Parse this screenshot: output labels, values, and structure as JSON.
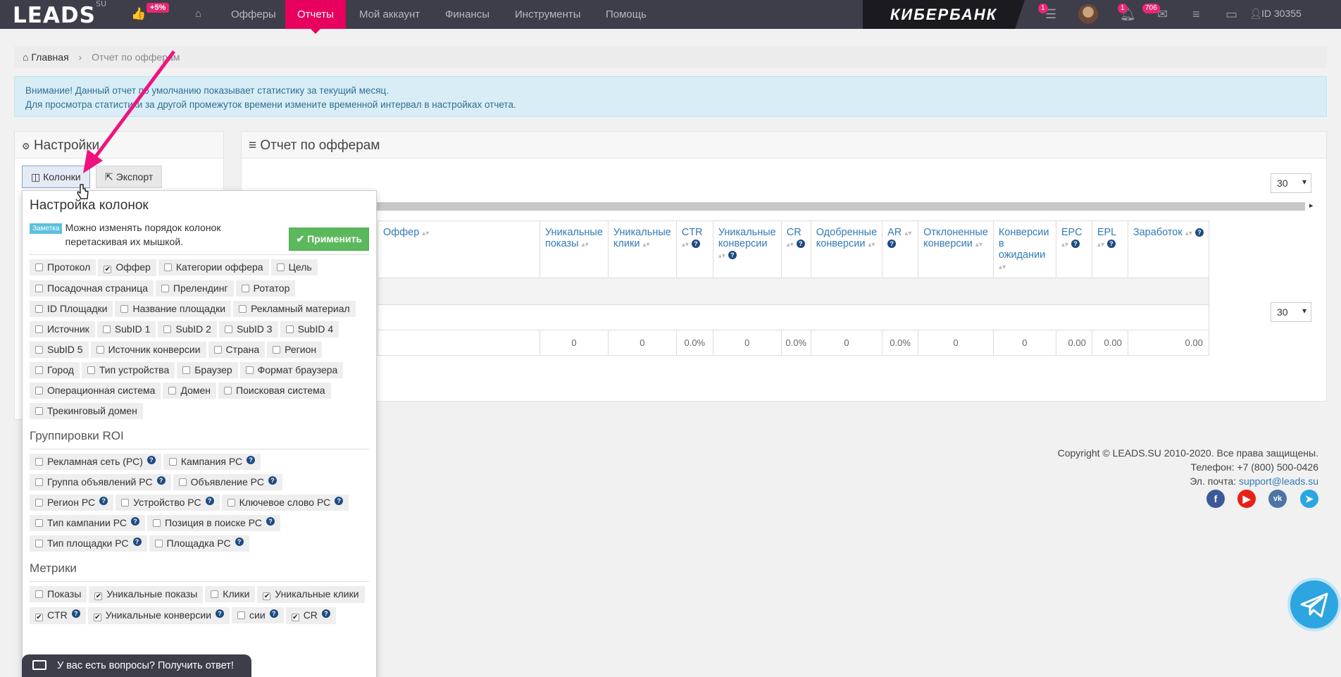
{
  "nav": {
    "logo": "LEADS",
    "logo_sup": "SU",
    "like_badge": "+5%",
    "items": [
      "Офферы",
      "Отчеты",
      "Мой аккаунт",
      "Финансы",
      "Инструменты",
      "Помощь"
    ],
    "active": "Отчеты",
    "partner_banner": "КИБЕРБАНК",
    "badge_tasks": "1",
    "badge_bell": "1",
    "badge_mail": "706",
    "user_id": "ID 30355"
  },
  "breadcrumb": {
    "home": "Главная",
    "current": "Отчет по офферам"
  },
  "alert": {
    "line1": "Внимание! Данный отчет по умолчанию показывает статистику за текущий месяц.",
    "line2": "Для просмотра статистики за другой промежуток времени измените временной интервал в настройках отчета."
  },
  "settings": {
    "title": "Настройки",
    "tab_columns": "Колонки",
    "tab_export": "Экспорт"
  },
  "report": {
    "title": "Отчет по офферам",
    "per_page": "30",
    "columns": [
      {
        "label": "Оффер",
        "help": false
      },
      {
        "label": "Уникальные показы",
        "help": false
      },
      {
        "label": "Уникальные клики",
        "help": false
      },
      {
        "label": "CTR",
        "help": true
      },
      {
        "label": "Уникальные конверсии",
        "help": true
      },
      {
        "label": "CR",
        "help": true
      },
      {
        "label": "Одобренные конверсии",
        "help": false
      },
      {
        "label": "AR",
        "help": true
      },
      {
        "label": "Отклоненные конверсии",
        "help": false
      },
      {
        "label": "Конверсии в ожидании",
        "help": false
      },
      {
        "label": "EPC",
        "help": true
      },
      {
        "label": "EPL",
        "help": true
      },
      {
        "label": "Заработок",
        "help": true
      }
    ],
    "totals": [
      "",
      "0",
      "0",
      "0.0%",
      "0",
      "0.0%",
      "0",
      "0.0%",
      "0",
      "0",
      "0.00",
      "0.00",
      "0.00"
    ]
  },
  "columns_popover": {
    "title": "Настройка колонок",
    "note_badge": "Заметка",
    "note_text": "Можно изменять порядок колонок перетаскивая их мышкой.",
    "apply": "Применить",
    "main": [
      {
        "label": "Протокол",
        "checked": false
      },
      {
        "label": "Оффер",
        "checked": true
      },
      {
        "label": "Категории оффера",
        "checked": false
      },
      {
        "label": "Цель",
        "checked": false
      },
      {
        "label": "Посадочная страница",
        "checked": false
      },
      {
        "label": "Прелендинг",
        "checked": false
      },
      {
        "label": "Ротатор",
        "checked": false
      },
      {
        "label": "ID Площадки",
        "checked": false
      },
      {
        "label": "Название площадки",
        "checked": false
      },
      {
        "label": "Рекламный материал",
        "checked": false
      },
      {
        "label": "Источник",
        "checked": false
      },
      {
        "label": "SubID 1",
        "checked": false
      },
      {
        "label": "SubID 2",
        "checked": false
      },
      {
        "label": "SubID 3",
        "checked": false
      },
      {
        "label": "SubID 4",
        "checked": false
      },
      {
        "label": "SubID 5",
        "checked": false
      },
      {
        "label": "Источник конверсии",
        "checked": false
      },
      {
        "label": "Страна",
        "checked": false
      },
      {
        "label": "Регион",
        "checked": false
      },
      {
        "label": "Город",
        "checked": false
      },
      {
        "label": "Тип устройства",
        "checked": false
      },
      {
        "label": "Браузер",
        "checked": false
      },
      {
        "label": "Формат браузера",
        "checked": false
      },
      {
        "label": "Операционная система",
        "checked": false
      },
      {
        "label": "Домен",
        "checked": false
      },
      {
        "label": "Поисковая система",
        "checked": false
      },
      {
        "label": "Трекинговый домен",
        "checked": false
      }
    ],
    "roi_title": "Группировки ROI",
    "roi": [
      {
        "label": "Рекламная сеть (РС)",
        "checked": false
      },
      {
        "label": "Кампания РС",
        "checked": false
      },
      {
        "label": "Группа объявлений РС",
        "checked": false
      },
      {
        "label": "Объявление РС",
        "checked": false
      },
      {
        "label": "Регион РС",
        "checked": false
      },
      {
        "label": "Устройство РС",
        "checked": false
      },
      {
        "label": "Ключевое слово РС",
        "checked": false
      },
      {
        "label": "Тип кампании РС",
        "checked": false
      },
      {
        "label": "Позиция в поиске РС",
        "checked": false
      },
      {
        "label": "Тип площадки РС",
        "checked": false
      },
      {
        "label": "Площадка РС",
        "checked": false
      }
    ],
    "metrics_title": "Метрики",
    "metrics": [
      {
        "label": "Показы",
        "checked": false,
        "help": false
      },
      {
        "label": "Уникальные показы",
        "checked": true,
        "help": false
      },
      {
        "label": "Клики",
        "checked": false,
        "help": false
      },
      {
        "label": "Уникальные клики",
        "checked": true,
        "help": false
      },
      {
        "label": "CTR",
        "checked": true,
        "help": true
      },
      {
        "label": "Уникальные конверсии",
        "checked": true,
        "help": true
      },
      {
        "label": "сии",
        "checked": false,
        "help": true
      },
      {
        "label": "CR",
        "checked": true,
        "help": true
      }
    ]
  },
  "footer": {
    "copyright": "Copyright © LEADS.SU 2010-2020. Все права защищены.",
    "phone": "Телефон: +7 (800) 500-0426",
    "email_label": "Эл. почта: ",
    "email": "support@leads.su"
  },
  "chat": {
    "label": "У вас есть вопросы? Получить ответ!"
  },
  "colors": {
    "accent": "#e7005e",
    "navbar": "#3e3d4a",
    "link": "#337ab7",
    "apply": "#5cb85c"
  }
}
